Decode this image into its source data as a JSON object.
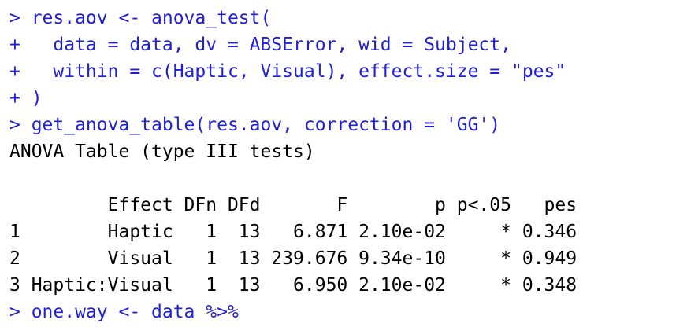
{
  "colors": {
    "input_text": "#1f1fd6",
    "output_text": "#000000",
    "background": "#ffffff"
  },
  "console": {
    "lines": [
      {
        "kind": "input",
        "text": "> res.aov <- anova_test("
      },
      {
        "kind": "input",
        "text": "+   data = data, dv = ABSError, wid = Subject,"
      },
      {
        "kind": "input",
        "text": "+   within = c(Haptic, Visual), effect.size = \"pes\""
      },
      {
        "kind": "input",
        "text": "+ )"
      },
      {
        "kind": "input",
        "text": "> get_anova_table(res.aov, correction = 'GG')"
      },
      {
        "kind": "output",
        "text": "ANOVA Table (type III tests)"
      },
      {
        "kind": "output",
        "text": ""
      },
      {
        "kind": "output",
        "text": "         Effect DFn DFd       F        p p<.05   pes"
      },
      {
        "kind": "output",
        "text": "1        Haptic   1  13   6.871 2.10e-02     * 0.346"
      },
      {
        "kind": "output",
        "text": "2        Visual   1  13 239.676 9.34e-10     * 0.949"
      },
      {
        "kind": "output",
        "text": "3 Haptic:Visual   1  13   6.950 2.10e-02     * 0.348"
      },
      {
        "kind": "input",
        "text": "> one.way <- data %>%"
      }
    ]
  }
}
